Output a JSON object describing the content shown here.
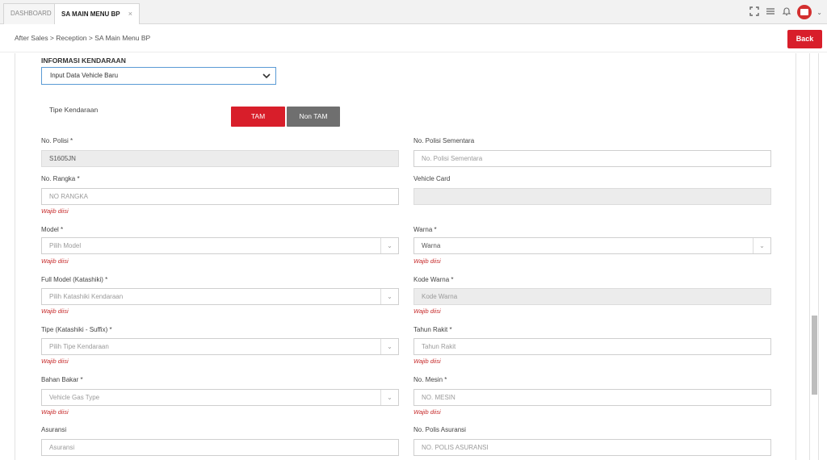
{
  "tabs": [
    {
      "label": "DASHBOARD"
    },
    {
      "label": "SA MAIN MENU BP",
      "close": "×"
    }
  ],
  "breadcrumb": "After Sales > Reception > SA Main Menu BP",
  "back_label": "Back",
  "section_title": "INFORMASI KENDARAAN",
  "vehicle_select": "Input Data Vehicle Baru",
  "type_label": "Tipe Kendaraan",
  "type_buttons": {
    "tam": "TAM",
    "nontam": "Non TAM"
  },
  "error_text": "Wajib diisi",
  "fields": {
    "no_polisi": {
      "label": "No. Polisi *",
      "value": "S1605JN"
    },
    "no_polisi_sementara": {
      "label": "No. Polisi Sementara",
      "placeholder": "No. Polisi Sementara"
    },
    "no_rangka": {
      "label": "No. Rangka *",
      "placeholder": "NO RANGKA"
    },
    "vehicle_card": {
      "label": "Vehicle Card",
      "value": ""
    },
    "model": {
      "label": "Model *",
      "placeholder": "Pilih Model"
    },
    "warna": {
      "label": "Warna *",
      "placeholder": "Warna"
    },
    "full_model": {
      "label": "Full Model (Katashiki) *",
      "placeholder": "Pilih Katashiki Kendaraan"
    },
    "kode_warna": {
      "label": "Kode Warna *",
      "placeholder": "Kode Warna"
    },
    "tipe": {
      "label": "Tipe (Katashiki - Suffix) *",
      "placeholder": "Pilih Tipe Kendaraan"
    },
    "tahun_rakit": {
      "label": "Tahun Rakit *",
      "placeholder": "Tahun Rakit"
    },
    "bahan_bakar": {
      "label": "Bahan Bakar *",
      "placeholder": "Vehicle Gas Type"
    },
    "no_mesin": {
      "label": "No. Mesin *",
      "placeholder": "NO. MESIN"
    },
    "asuransi": {
      "label": "Asuransi",
      "placeholder": "Asuransi"
    },
    "no_polis": {
      "label": "No. Polis Asuransi",
      "placeholder": "NO. POLIS ASURANSI"
    }
  },
  "colors": {
    "primary_red": "#d81e2a",
    "error": "#c62828",
    "focus_blue": "#5b9bd5"
  }
}
